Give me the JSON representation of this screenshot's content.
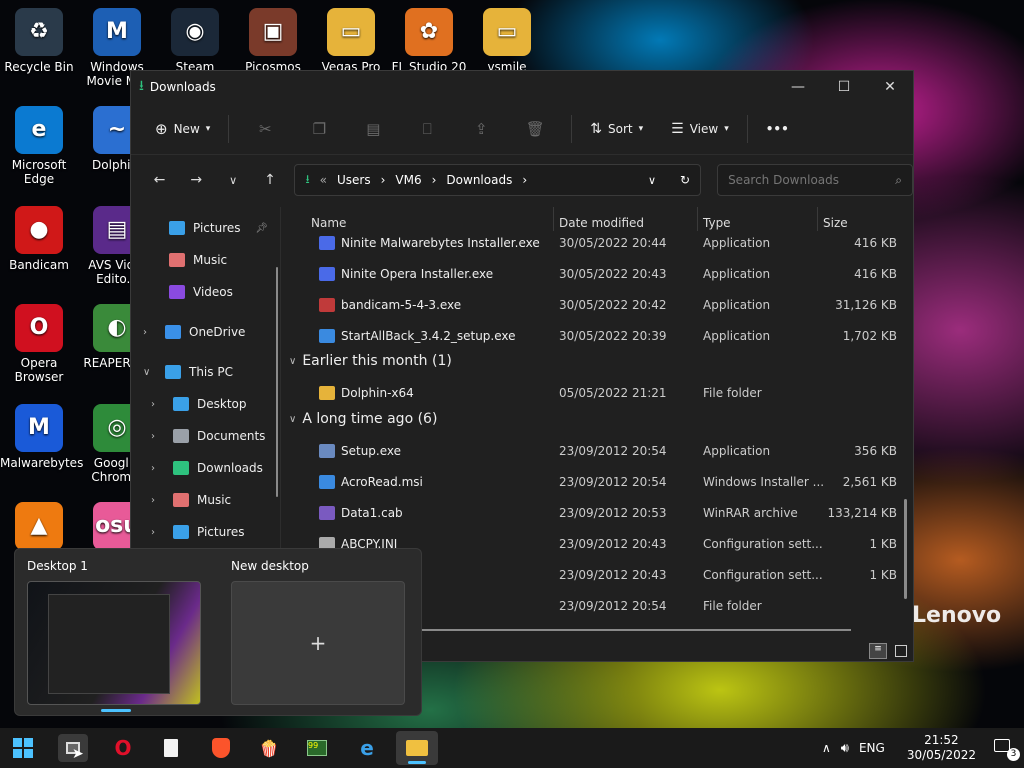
{
  "desktop": {
    "icons": [
      {
        "label": "Recycle Bin",
        "glyph": "♻",
        "color": "#2a3a4a"
      },
      {
        "label": "Windows Movie M...",
        "glyph": "M",
        "color": "#1d5fb4"
      },
      {
        "label": "Steam",
        "glyph": "◉",
        "color": "#1b2838"
      },
      {
        "label": "Picosmos",
        "glyph": "▣",
        "color": "#7a3a2a"
      },
      {
        "label": "Vegas Pro",
        "glyph": "▭",
        "color": "#e6b33a"
      },
      {
        "label": "FL Studio 20",
        "glyph": "✿",
        "color": "#e07020"
      },
      {
        "label": "vsmile",
        "glyph": "▭",
        "color": "#e6b33a"
      },
      {
        "label": "Microsoft Edge",
        "glyph": "e",
        "color": "#0b7ad1"
      },
      {
        "label": "Dolphi...",
        "glyph": "~",
        "color": "#2b6fd1"
      },
      {
        "label": "Bandicam",
        "glyph": "●",
        "color": "#d01818"
      },
      {
        "label": "AVS Vid... Edito...",
        "glyph": "▤",
        "color": "#5a2a8a"
      },
      {
        "label": "Opera Browser",
        "glyph": "O",
        "color": "#d0101f"
      },
      {
        "label": "REAPER (...",
        "glyph": "◐",
        "color": "#3a8a3a"
      },
      {
        "label": "Malwarebytes",
        "glyph": "M",
        "color": "#1a5ad8"
      },
      {
        "label": "Googl... Chrom...",
        "glyph": "◎",
        "color": "#2e8b3a"
      },
      {
        "label": "VLC",
        "glyph": "▲",
        "color": "#ee7a10"
      },
      {
        "label": "osu!",
        "glyph": "osu",
        "color": "#e85a98"
      }
    ],
    "brand": "Lenovo"
  },
  "explorer": {
    "title": "Downloads",
    "toolbar": {
      "new": "New",
      "sort": "Sort",
      "view": "View",
      "more": "•••"
    },
    "address": {
      "crumbs": [
        "Users",
        "VM6",
        "Downloads"
      ]
    },
    "search_placeholder": "Search Downloads",
    "nav": {
      "quick": [
        {
          "label": "Pictures",
          "color": "#3aa0e8",
          "pinned": true
        },
        {
          "label": "Music",
          "color": "#e07070"
        },
        {
          "label": "Videos",
          "color": "#8a4ae0"
        }
      ],
      "onedrive": "OneDrive",
      "thispc": "This PC",
      "pc": [
        {
          "label": "Desktop",
          "color": "#3aa0e8"
        },
        {
          "label": "Documents",
          "color": "#9aa0a8"
        },
        {
          "label": "Downloads",
          "color": "#2ec27e"
        },
        {
          "label": "Music",
          "color": "#e07070"
        },
        {
          "label": "Pictures",
          "color": "#3aa0e8"
        }
      ]
    },
    "columns": {
      "name": "Name",
      "date": "Date modified",
      "type": "Type",
      "size": "Size"
    },
    "rows_top": [
      {
        "name": "Ninite Malwarebytes Installer.exe",
        "date": "30/05/2022 20:44",
        "type": "Application",
        "size": "416 KB",
        "color": "#4a6ae8"
      },
      {
        "name": "Ninite Opera Installer.exe",
        "date": "30/05/2022 20:43",
        "type": "Application",
        "size": "416 KB",
        "color": "#4a6ae8"
      },
      {
        "name": "bandicam-5-4-3.exe",
        "date": "30/05/2022 20:42",
        "type": "Application",
        "size": "31,126 KB",
        "color": "#c03a3a"
      },
      {
        "name": "StartAllBack_3.4.2_setup.exe",
        "date": "30/05/2022 20:39",
        "type": "Application",
        "size": "1,702 KB",
        "color": "#3a8ae0"
      }
    ],
    "group_month": "Earlier this month (1)",
    "rows_month": [
      {
        "name": "Dolphin-x64",
        "date": "05/05/2022 21:21",
        "type": "File folder",
        "size": "",
        "color": "#e6b33a"
      }
    ],
    "group_old": "A long time ago (6)",
    "rows_old": [
      {
        "name": "Setup.exe",
        "date": "23/09/2012 20:54",
        "type": "Application",
        "size": "356 KB",
        "color": "#6a8ac0"
      },
      {
        "name": "AcroRead.msi",
        "date": "23/09/2012 20:54",
        "type": "Windows Installer ...",
        "size": "2,561 KB",
        "color": "#3a8ae0"
      },
      {
        "name": "Data1.cab",
        "date": "23/09/2012 20:53",
        "type": "WinRAR archive",
        "size": "133,214 KB",
        "color": "#7a5ac0"
      },
      {
        "name": "ABCPY.INI",
        "date": "23/09/2012 20:43",
        "type": "Configuration sett...",
        "size": "1 KB",
        "color": "#aaaaaa"
      },
      {
        "name": "",
        "date": "23/09/2012 20:43",
        "type": "Configuration sett...",
        "size": "1 KB",
        "color": "#aaaaaa"
      },
      {
        "name": "",
        "date": "23/09/2012 20:54",
        "type": "File folder",
        "size": "",
        "color": "#e6b33a"
      }
    ]
  },
  "vdesk": {
    "desktop1": "Desktop 1",
    "new": "New desktop",
    "plus": "+"
  },
  "taskbar": {
    "lang": "ENG",
    "time": "21:52",
    "date": "30/05/2022",
    "notif": "3"
  }
}
